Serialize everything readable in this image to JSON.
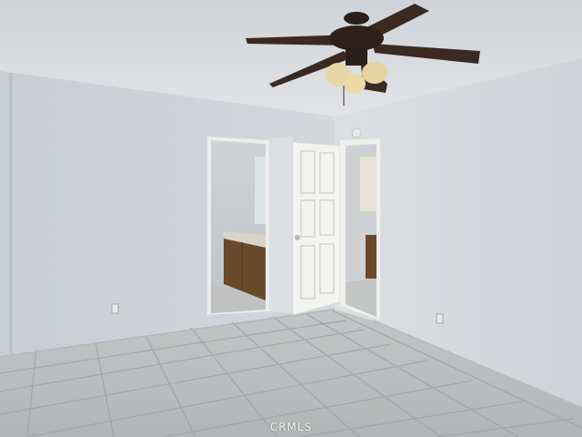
{
  "scene": {
    "description_tag": "empty-bedroom-with-ceiling-fan",
    "watermark_text": "CRMLS"
  },
  "palette": {
    "ceiling": "#d9dbdf",
    "left_wall": "#cdd2d8",
    "right_wall": "#d6dade",
    "floor": "#b9bcbe",
    "grout": "#a4a7a9",
    "door": "#f2f2ef",
    "trim": "#ececea",
    "cabinet": "#6b4a2c",
    "fan_blade": "#3b2a22",
    "fan_light": "#e8d7a6"
  },
  "icons": {
    "ceiling_fan": "ceiling-fan-icon",
    "outlet": "outlet-icon",
    "door_knob": "door-knob-icon"
  }
}
